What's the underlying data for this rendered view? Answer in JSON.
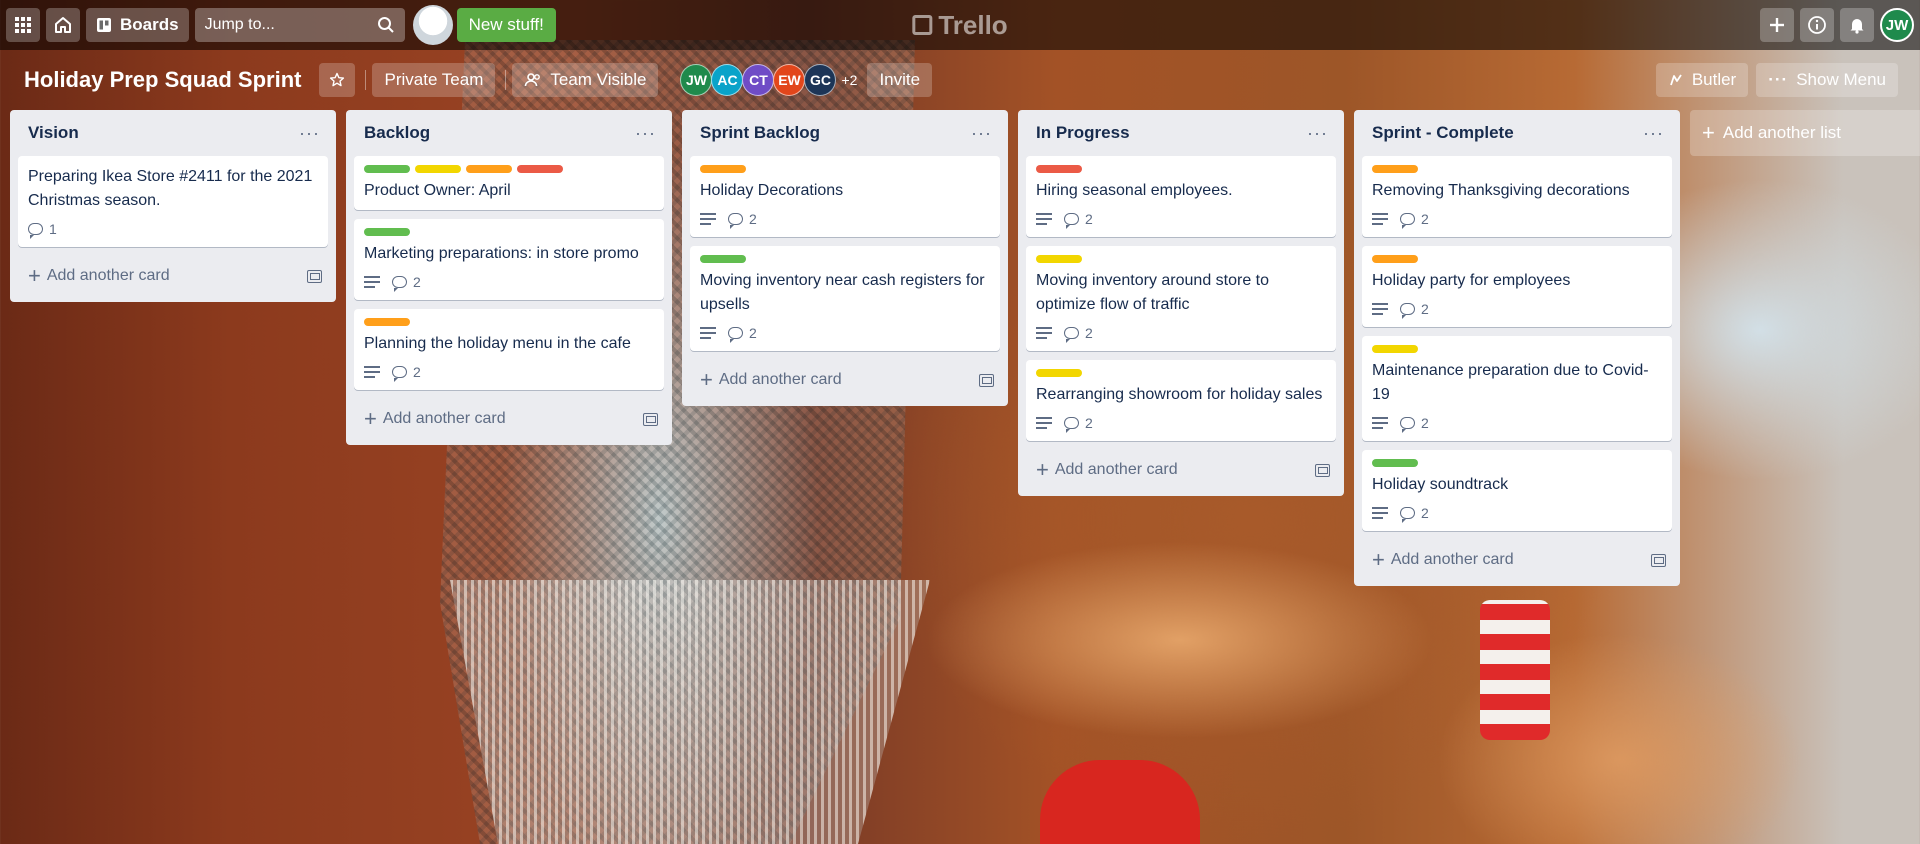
{
  "header": {
    "boards_label": "Boards",
    "search_placeholder": "Jump to...",
    "new_stuff_label": "New stuff!",
    "logo_text": "Trello",
    "user_initials": "JW"
  },
  "board": {
    "title": "Holiday Prep Squad Sprint",
    "team_label": "Private Team",
    "visibility_label": "Team Visible",
    "members": [
      {
        "initials": "JW",
        "color": "#1f8a4c"
      },
      {
        "initials": "AC",
        "color": "#0aa3c9"
      },
      {
        "initials": "CT",
        "color": "#6f4cc6"
      },
      {
        "initials": "EW",
        "color": "#e2461b"
      },
      {
        "initials": "GC",
        "color": "#1d3557"
      }
    ],
    "more_members": "+2",
    "invite_label": "Invite",
    "butler_label": "Butler",
    "show_menu_label": "Show Menu"
  },
  "label_colors": {
    "green": "#61bd4f",
    "yellow": "#f2d600",
    "orange": "#ff9f1a",
    "red": "#eb5a46"
  },
  "add_card_label": "Add another card",
  "add_list_label": "Add another list",
  "lists": [
    {
      "title": "Vision",
      "cards": [
        {
          "title": "Preparing Ikea Store #2411 for the 2021 Christmas season.",
          "labels": [],
          "description": false,
          "comments": "1"
        }
      ]
    },
    {
      "title": "Backlog",
      "cards": [
        {
          "title": "Product Owner: April",
          "labels": [
            "green",
            "yellow",
            "orange",
            "red"
          ],
          "description": false,
          "comments": null
        },
        {
          "title": "Marketing preparations: in store promo",
          "labels": [
            "green"
          ],
          "description": true,
          "comments": "2"
        },
        {
          "title": "Planning the holiday menu in the cafe",
          "labels": [
            "orange"
          ],
          "description": true,
          "comments": "2"
        }
      ]
    },
    {
      "title": "Sprint Backlog",
      "cards": [
        {
          "title": "Holiday Decorations",
          "labels": [
            "orange"
          ],
          "description": true,
          "comments": "2"
        },
        {
          "title": "Moving inventory near cash registers for upsells",
          "labels": [
            "green"
          ],
          "description": true,
          "comments": "2"
        }
      ]
    },
    {
      "title": "In Progress",
      "cards": [
        {
          "title": "Hiring seasonal employees.",
          "labels": [
            "red"
          ],
          "description": true,
          "comments": "2"
        },
        {
          "title": "Moving inventory around store to optimize flow of traffic",
          "labels": [
            "yellow"
          ],
          "description": true,
          "comments": "2"
        },
        {
          "title": "Rearranging showroom for holiday sales",
          "labels": [
            "yellow"
          ],
          "description": true,
          "comments": "2"
        }
      ]
    },
    {
      "title": "Sprint - Complete",
      "cards": [
        {
          "title": "Removing Thanksgiving decorations",
          "labels": [
            "orange"
          ],
          "description": true,
          "comments": "2"
        },
        {
          "title": "Holiday party for employees",
          "labels": [
            "orange"
          ],
          "description": true,
          "comments": "2"
        },
        {
          "title": "Maintenance preparation due to Covid-19",
          "labels": [
            "yellow"
          ],
          "description": true,
          "comments": "2"
        },
        {
          "title": "Holiday soundtrack",
          "labels": [
            "green"
          ],
          "description": true,
          "comments": "2"
        }
      ]
    }
  ]
}
